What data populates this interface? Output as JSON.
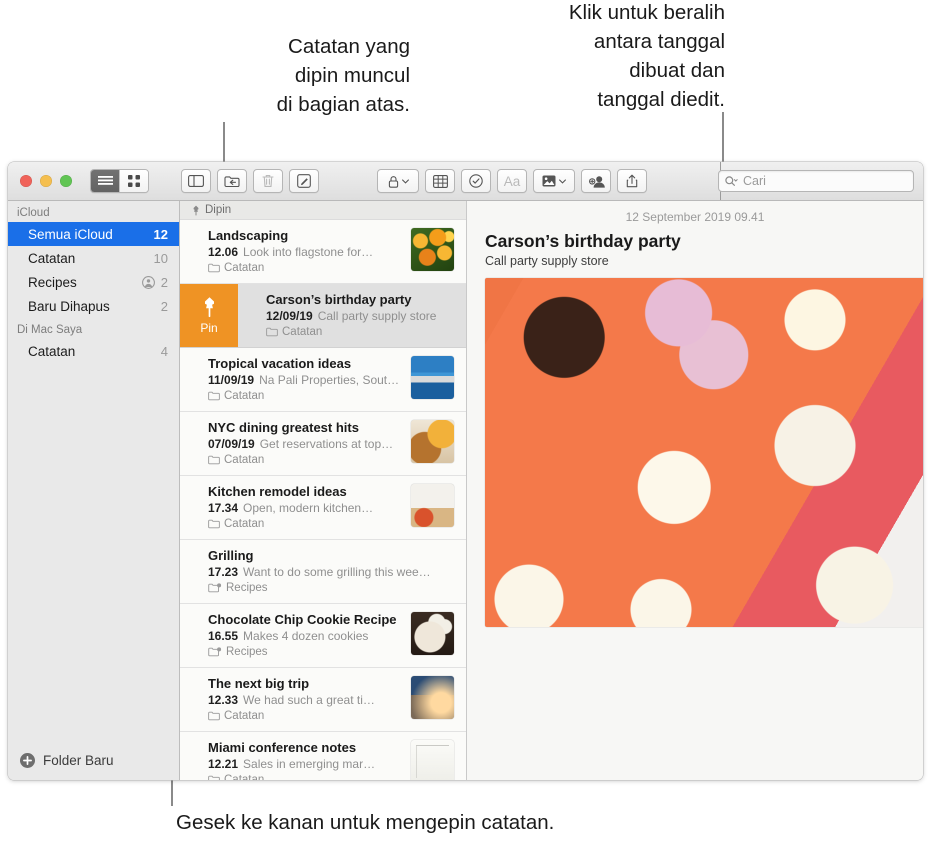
{
  "callouts": {
    "pinned": "Catatan yang\ndipin muncul\ndi bagian atas.",
    "dates": "Klik untuk beralih\nantara tanggal\ndibuat dan\ntanggal diedit.",
    "swipe": "Gesek ke kanan untuk mengepin catatan."
  },
  "toolbar": {
    "view_list": "list-view",
    "view_grid": "grid-view",
    "sidebar_toggle": "sidebar-toggle",
    "move_to_folder": "move-to-folder",
    "delete": "delete",
    "compose": "compose",
    "lock": "lock",
    "table": "table",
    "checklist": "checklist",
    "format": "Aa",
    "media": "media",
    "add_people": "add-people",
    "share": "share",
    "search_placeholder": "Cari"
  },
  "sidebar": {
    "sections": [
      {
        "title": "iCloud",
        "items": [
          {
            "label": "Semua iCloud",
            "count": "12",
            "selected": true,
            "shared": false
          },
          {
            "label": "Catatan",
            "count": "10",
            "selected": false,
            "shared": false
          },
          {
            "label": "Recipes",
            "count": "2",
            "selected": false,
            "shared": true
          },
          {
            "label": "Baru Dihapus",
            "count": "2",
            "selected": false,
            "shared": false
          }
        ]
      },
      {
        "title": "Di Mac Saya",
        "items": [
          {
            "label": "Catatan",
            "count": "4",
            "selected": false,
            "shared": false
          }
        ]
      }
    ],
    "new_folder": "Folder Baru"
  },
  "notelist": {
    "pinned_header": "Dipin",
    "pin_action_label": "Pin",
    "notes": [
      {
        "title": "Landscaping",
        "time": "12.06",
        "preview": "Look into flagstone for…",
        "folder": "Catatan",
        "shared": false,
        "selected": false,
        "thumb": "img-flowers"
      },
      {
        "title": "Carson’s birthday party",
        "time": "12/09/19",
        "preview": "Call party supply store",
        "folder": "Catatan",
        "shared": false,
        "selected": true,
        "thumb": ""
      },
      {
        "title": "Tropical vacation ideas",
        "time": "11/09/19",
        "preview": "Na Pali Properties, Sout…",
        "folder": "Catatan",
        "shared": false,
        "selected": false,
        "thumb": "img-santorini"
      },
      {
        "title": "NYC dining greatest hits",
        "time": "07/09/19",
        "preview": "Get reservations at top…",
        "folder": "Catatan",
        "shared": false,
        "selected": false,
        "thumb": "img-burger"
      },
      {
        "title": "Kitchen remodel ideas",
        "time": "17.34",
        "preview": "Open, modern kitchen…",
        "folder": "Catatan",
        "shared": false,
        "selected": false,
        "thumb": "img-kitchen"
      },
      {
        "title": "Grilling",
        "time": "17.23",
        "preview": "Want to do some grilling this wee…",
        "folder": "Recipes",
        "shared": true,
        "selected": false,
        "thumb": ""
      },
      {
        "title": "Chocolate Chip Cookie Recipe",
        "time": "16.55",
        "preview": "Makes 4 dozen cookies",
        "folder": "Recipes",
        "shared": true,
        "selected": false,
        "thumb": "img-cookies"
      },
      {
        "title": "The next big trip",
        "time": "12.33",
        "preview": "We had such a great ti…",
        "folder": "Catatan",
        "shared": false,
        "selected": false,
        "thumb": "img-bike"
      },
      {
        "title": "Miami conference notes",
        "time": "12.21",
        "preview": "Sales in emerging mar…",
        "folder": "Catatan",
        "shared": false,
        "selected": false,
        "thumb": "img-sketch"
      }
    ]
  },
  "detail": {
    "date": "12 September 2019 09.41",
    "title": "Carson’s birthday party",
    "body": "Call party supply store",
    "photo": "img-cupcakes"
  },
  "colors": {
    "selection_blue": "#1a6fe8",
    "pin_orange": "#ef9324",
    "window_bg": "#ececec"
  }
}
